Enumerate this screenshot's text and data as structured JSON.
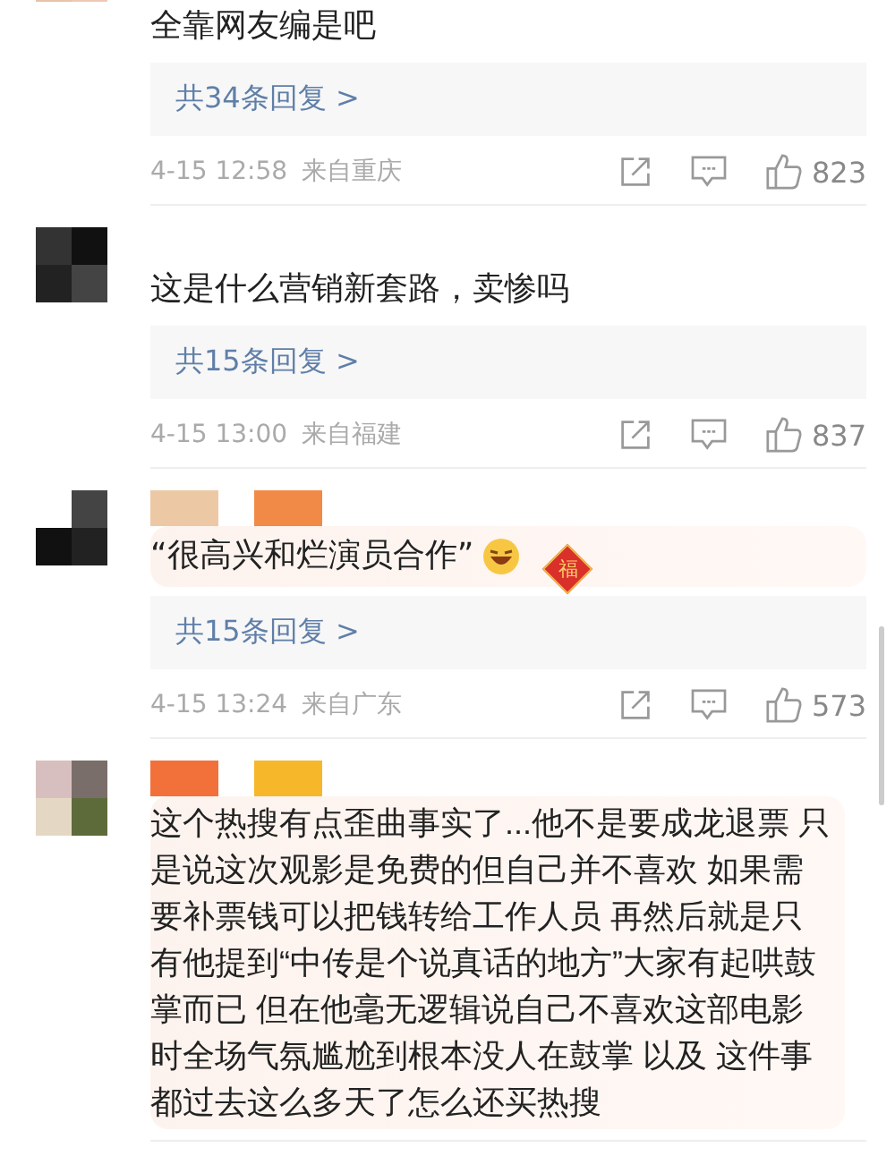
{
  "comments": [
    {
      "text": "全靠网友编是吧",
      "replies": "共34条回复 >",
      "time": "4-15 12:58",
      "location": "来自重庆",
      "likes": "823",
      "decorated": false
    },
    {
      "text": "这是什么营销新套路，卖惨吗",
      "replies": "共15条回复 >",
      "time": "4-15 13:00",
      "location": "来自福建",
      "likes": "837",
      "decorated": false
    },
    {
      "name_tags": true,
      "text": "“很高兴和烂演员合作”",
      "emoji": true,
      "badge": "福",
      "replies": "共15条回复 >",
      "time": "4-15 13:24",
      "location": "来自广东",
      "likes": "573",
      "decorated": true
    },
    {
      "name_tags": true,
      "text": "这个热搜有点歪曲事实了...他不是要成龙退票 只是说这次观影是免费的但自己并不喜欢 如果需要补票钱可以把钱转给工作人员 再然后就是只有他提到“中传是个说真话的地方”大家有起哄鼓掌而已 但在他毫无逻辑说自己不喜欢这部电影时全场气氛尴尬到根本没人在鼓掌 以及 这件事都过去这么多天了怎么还买热搜",
      "decorated": true
    }
  ]
}
